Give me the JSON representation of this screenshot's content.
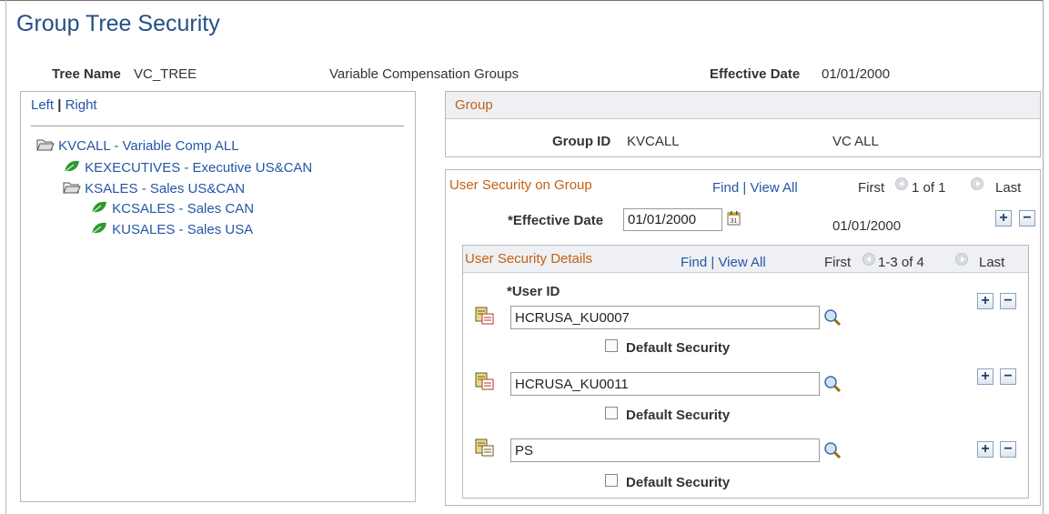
{
  "page": {
    "title": "Group Tree Security"
  },
  "header": {
    "tree_name_label": "Tree Name",
    "tree_name": "VC_TREE",
    "tree_desc": "Variable Compensation Groups",
    "eff_date_label": "Effective Date",
    "eff_date": "01/01/2000"
  },
  "tree": {
    "left_link": "Left",
    "sep": "|",
    "right_link": "Right",
    "nodes": [
      {
        "label": "KVCALL - Variable Comp ALL",
        "icon": "folder-open-icon"
      },
      {
        "label": "KEXECUTIVES - Executive US&CAN",
        "icon": "leaf-icon"
      },
      {
        "label": "KSALES - Sales US&CAN",
        "icon": "folder-open-icon"
      },
      {
        "label": "KCSALES - Sales CAN",
        "icon": "leaf-icon"
      },
      {
        "label": "KUSALES - Sales USA",
        "icon": "leaf-icon"
      }
    ]
  },
  "group": {
    "header": "Group",
    "id_label": "Group ID",
    "id": "KVCALL",
    "desc": "VC ALL"
  },
  "user_security": {
    "header": "User Security on Group",
    "find": "Find",
    "view_all": "View All",
    "sep": "|",
    "first": "First",
    "count": "1 of 1",
    "last": "Last",
    "eff_date_label": "*Effective Date",
    "eff_date_value": "01/01/2000",
    "eff_date_display": "01/01/2000",
    "add": "+",
    "remove": "−"
  },
  "details": {
    "header": "User Security Details",
    "find": "Find",
    "view_all": "View All",
    "sep": "|",
    "first": "First",
    "count": "1-3 of 4",
    "last": "Last",
    "user_id_label": "*User ID",
    "default_label": "Default Security",
    "add": "+",
    "remove": "−",
    "rows": [
      {
        "user_id": "HCRUSA_KU0007",
        "default_security": false
      },
      {
        "user_id": "HCRUSA_KU0011",
        "default_security": false
      },
      {
        "user_id": "PS",
        "default_security": false
      }
    ]
  },
  "colors": {
    "title": "#254f84",
    "link": "#2456a6",
    "section_header": "#c26014",
    "leaf": "#2e9a2e"
  }
}
